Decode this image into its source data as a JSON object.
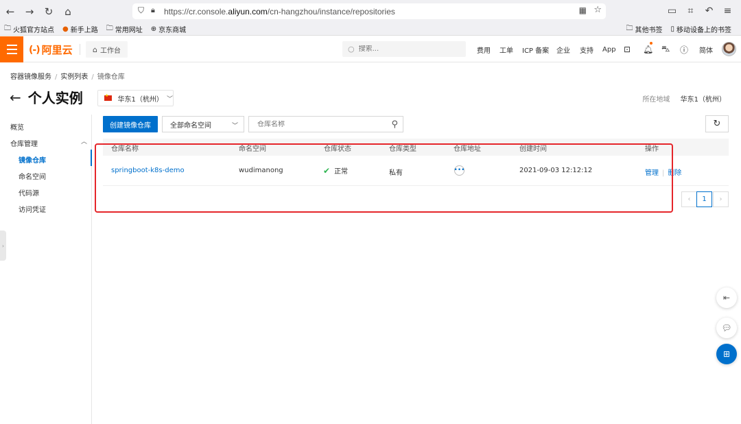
{
  "browser": {
    "url_prefix": "https://cr.console.",
    "url_domain": "aliyun.com",
    "url_path": "/cn-hangzhou/instance/repositories"
  },
  "bookmarks": {
    "items": [
      "火狐官方站点",
      "新手上路",
      "常用网址",
      "京东商城"
    ],
    "right": [
      "其他书签",
      "移动设备上的书签"
    ]
  },
  "topbar": {
    "logo_mark": "(-)",
    "logo_text": "阿里云",
    "workbench": "工作台",
    "search_placeholder": "搜索...",
    "links": [
      "费用",
      "工单",
      "ICP 备案",
      "企业",
      "支持",
      "App"
    ],
    "lang": "简体"
  },
  "breadcrumb": [
    "容器镜像服务",
    "实例列表",
    "镜像仓库"
  ],
  "page": {
    "back_glyph": "←",
    "title": "个人实例",
    "region_select": "华东1（杭州）",
    "region_label": "所在地域",
    "region_value": "华东1（杭州）"
  },
  "leftnav": {
    "overview": "概览",
    "repo_mgmt": "仓库管理",
    "items": [
      "镜像仓库",
      "命名空间",
      "代码源",
      "访问凭证"
    ]
  },
  "toolbar": {
    "create_button": "创建镜像仓库",
    "namespace_select": "全部命名空间",
    "search_placeholder": "仓库名称"
  },
  "table": {
    "columns": [
      "仓库名称",
      "命名空间",
      "仓库状态",
      "仓库类型",
      "仓库地址",
      "创建时间",
      "操作"
    ],
    "rows": [
      {
        "name": "springboot-k8s-demo",
        "namespace": "wudimanong",
        "status": "正常",
        "type": "私有",
        "created": "2021-09-03 12:12:12",
        "op_manage": "管理",
        "op_delete": "删除"
      }
    ]
  },
  "pagination": {
    "current": "1"
  },
  "colors": {
    "brand_orange": "#ff6a00",
    "primary_blue": "#0070cc",
    "highlight_red": "#e5252a",
    "ok_green": "#2fb552"
  }
}
